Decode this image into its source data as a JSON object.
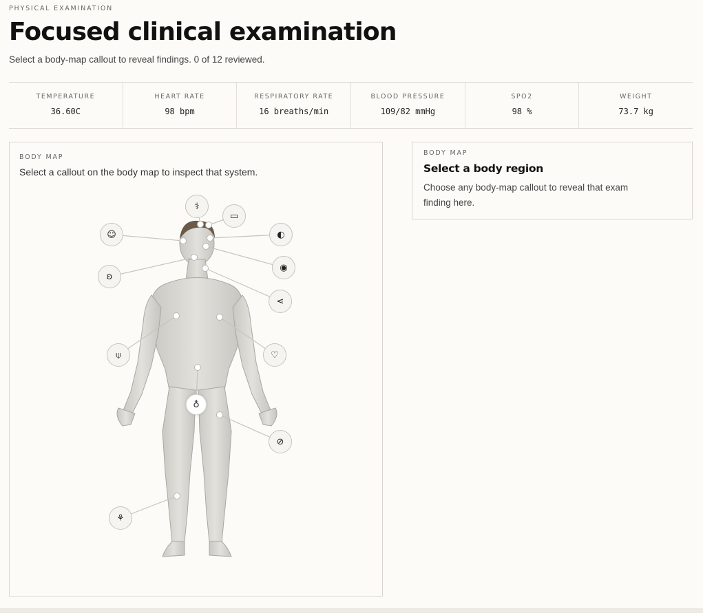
{
  "header": {
    "eyebrow": "PHYSICAL EXAMINATION",
    "title": "Focused clinical examination",
    "subtitle": "Select a body-map callout to reveal findings. 0 of 12 reviewed."
  },
  "vitals": [
    {
      "label": "TEMPERATURE",
      "value": "36.60C"
    },
    {
      "label": "HEART RATE",
      "value": "98 bpm"
    },
    {
      "label": "RESPIRATORY RATE",
      "value": "16 breaths/min"
    },
    {
      "label": "BLOOD PRESSURE",
      "value": "109/82 mmHg"
    },
    {
      "label": "SPO2",
      "value": "98 %"
    },
    {
      "label": "WEIGHT",
      "value": "73.7 kg"
    }
  ],
  "body_map": {
    "eyebrow": "BODY MAP",
    "instruction": "Select a callout on the body map to inspect that system.",
    "callouts": [
      {
        "name": "stethoscope-icon",
        "glyph": "⚕"
      },
      {
        "name": "speech-bubble-icon",
        "glyph": "▭"
      },
      {
        "name": "smiley-face-icon",
        "glyph": "☺"
      },
      {
        "name": "brain-icon",
        "glyph": "◐"
      },
      {
        "name": "eye-icon",
        "glyph": "◉"
      },
      {
        "name": "ear-icon",
        "glyph": "ʚ"
      },
      {
        "name": "lymph-node-icon",
        "glyph": "⋖"
      },
      {
        "name": "lungs-icon",
        "glyph": "⍦"
      },
      {
        "name": "heart-icon",
        "glyph": "♡"
      },
      {
        "name": "abdomen-drop-icon",
        "glyph": "♁"
      },
      {
        "name": "bandage-icon",
        "glyph": "⊘"
      },
      {
        "name": "foot-icon",
        "glyph": "⚘"
      }
    ]
  },
  "finding_panel": {
    "eyebrow": "BODY MAP",
    "heading": "Select a body region",
    "body": "Choose any body-map callout to reveal that exam finding here."
  },
  "colors": {
    "background": "#fcfbf7",
    "border": "#d8d6cf",
    "body_fill": "#d9d8d3",
    "hair": "#6b5a48"
  }
}
